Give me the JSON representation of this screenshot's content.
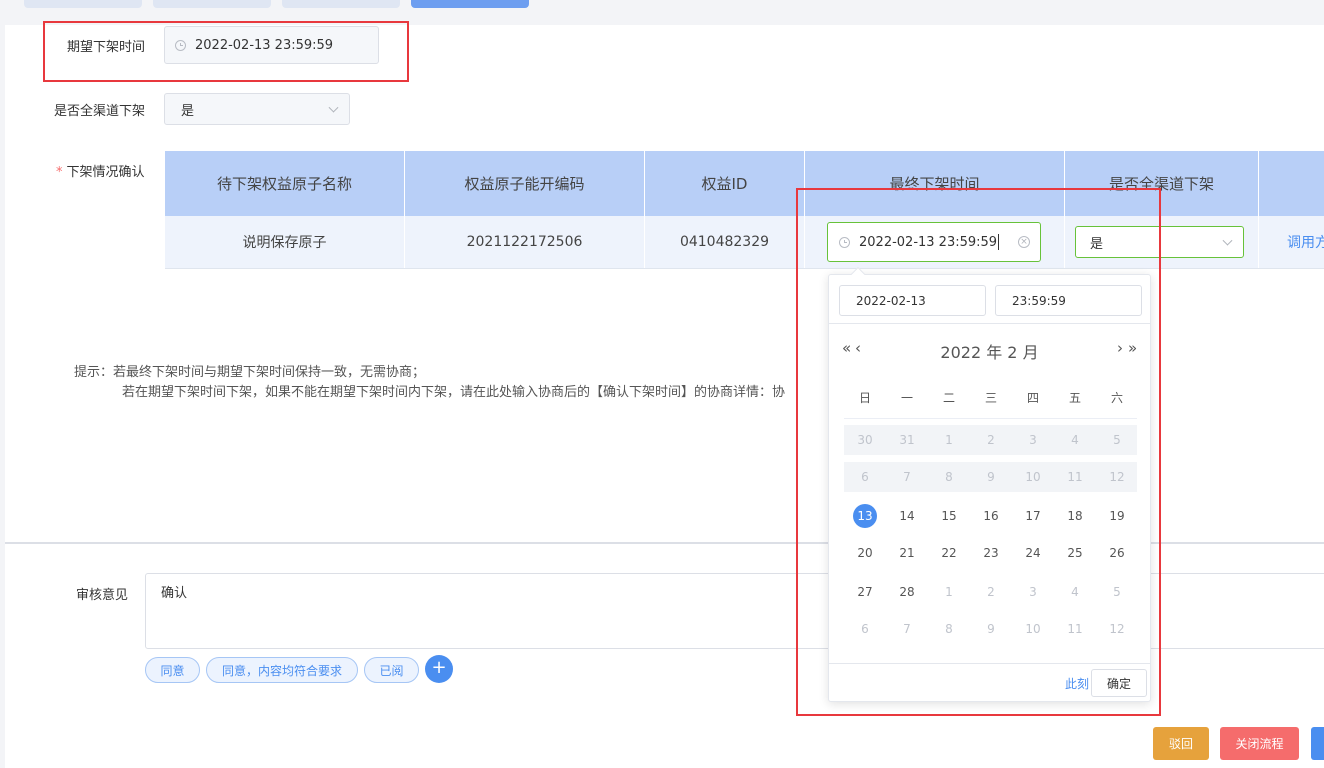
{
  "form": {
    "expected_label": "期望下架时间",
    "expected_value": "2022-02-13 23:59:59",
    "all_channels_label": "是否全渠道下架",
    "all_channels_value": "是",
    "confirm_label": "下架情况确认"
  },
  "table": {
    "headers": [
      "待下架权益原子名称",
      "权益原子能开编码",
      "权益ID",
      "最终下架时间",
      "是否全渠道下架"
    ],
    "row": {
      "name": "说明保存原子",
      "code": "2021122172506",
      "rights_id": "0410482329",
      "final_time": "2022-02-13 23:59:59",
      "all_channels": "是",
      "action": "调用方"
    }
  },
  "hint": {
    "line1": "提示：若最终下架时间与期望下架时间保持一致，无需协商；",
    "line2": "若在期望下架时间下架，如果不能在期望下架时间内下架，请在此处输入协商后的【确认下架时间】的协商详情：协"
  },
  "review": {
    "label": "审核意见",
    "value": "确认",
    "chips": [
      "同意",
      "同意，内容均符合要求",
      "已阅"
    ],
    "add": "+"
  },
  "buttons": {
    "reject": "驳回",
    "close": "关闭流程"
  },
  "picker": {
    "date_value": "2022-02-13",
    "time_value": "23:59:59",
    "prev_year": "«",
    "prev_month": "‹",
    "next_month": "›",
    "next_year": "»",
    "title": "2022 年  2 月",
    "weekdays": [
      "日",
      "一",
      "二",
      "三",
      "四",
      "五",
      "六"
    ],
    "weeks": [
      [
        "30",
        "31",
        "1",
        "2",
        "3",
        "4",
        "5"
      ],
      [
        "6",
        "7",
        "8",
        "9",
        "10",
        "11",
        "12"
      ],
      [
        "13",
        "14",
        "15",
        "16",
        "17",
        "18",
        "19"
      ],
      [
        "20",
        "21",
        "22",
        "23",
        "24",
        "25",
        "26"
      ],
      [
        "27",
        "28",
        "1",
        "2",
        "3",
        "4",
        "5"
      ],
      [
        "6",
        "7",
        "8",
        "9",
        "10",
        "11",
        "12"
      ]
    ],
    "now": "此刻",
    "ok": "确定"
  },
  "colors": {
    "primary": "#4a8ef0",
    "highlight": "#e8383d",
    "success_border": "#67c23a",
    "warning": "#e6a23c",
    "danger": "#f56c6c"
  }
}
